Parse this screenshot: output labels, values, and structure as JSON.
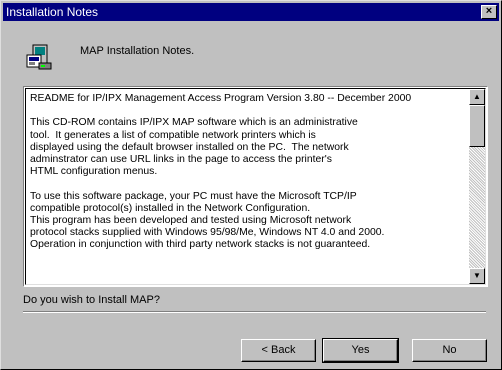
{
  "window": {
    "title": "Installation Notes",
    "close_glyph": "×"
  },
  "header": {
    "icon": "installer-icon",
    "text": "MAP Installation Notes."
  },
  "notes": {
    "text": "README for IP/IPX Management Access Program Version 3.80 -- December 2000\n\nThis CD-ROM contains IP/IPX MAP software which is an administrative\ntool.  It generates a list of compatible network printers which is\ndisplayed using the default browser installed on the PC.  The network\nadminstrator can use URL links in the page to access the printer's\nHTML configuration menus.\n\nTo use this software package, your PC must have the Microsoft TCP/IP\ncompatible protocol(s) installed in the Network Configuration.\nThis program has been developed and tested using Microsoft network\nprotocol stacks supplied with Windows 95/98/Me, Windows NT 4.0 and 2000.\nOperation in conjunction with third party network stacks is not guaranteed.",
    "scroll_up": "▲",
    "scroll_down": "▼"
  },
  "prompt": {
    "question": "Do you wish to Install MAP?"
  },
  "buttons": {
    "back": "< Back",
    "yes": "Yes",
    "no": "No"
  },
  "colors": {
    "title_bar": "#000080",
    "face": "#c0c0c0"
  }
}
